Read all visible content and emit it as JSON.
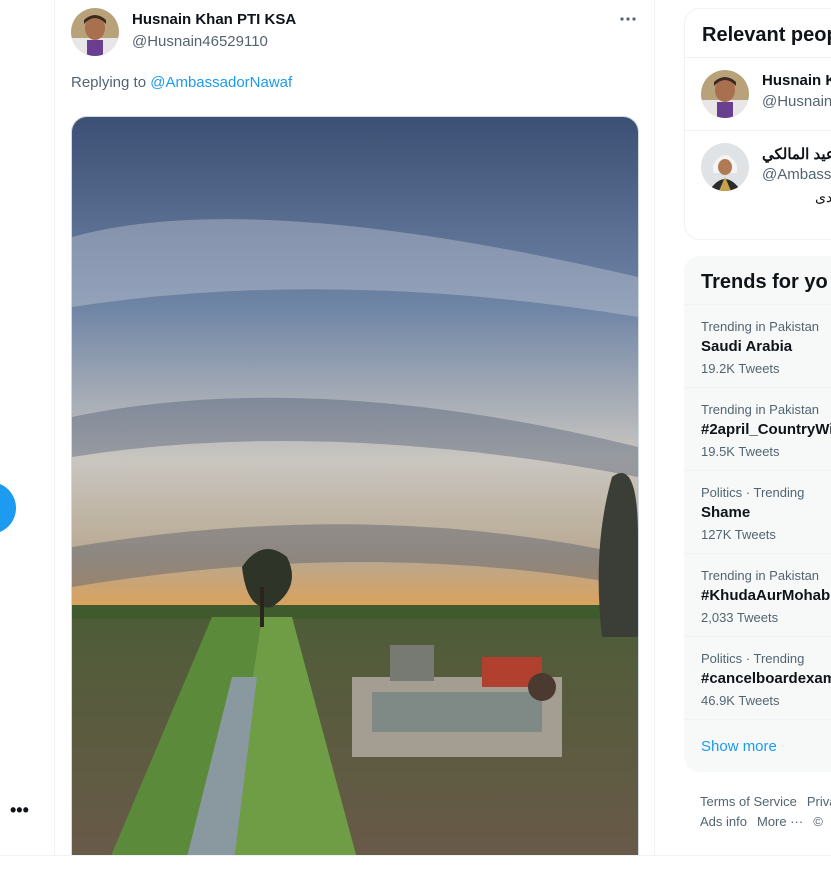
{
  "tweet": {
    "display_name": "Husnain Khan PTI KSA",
    "handle": "@Husnain46529110",
    "more_icon": "more-horizontal-icon",
    "replying_prefix": "Replying to",
    "replying_mention": "@AmbassadorNawaf"
  },
  "left_rail": {
    "more_label": "•••"
  },
  "relevant_people": {
    "title": "Relevant peop",
    "people": [
      {
        "name": "Husnain K",
        "handle": "@Husnain4",
        "bio": ""
      },
      {
        "name": "عيد المالكي",
        "handle": "@Ambassa",
        "bio": "دى"
      }
    ]
  },
  "trends": {
    "title": "Trends for yo",
    "items": [
      {
        "context": "Trending in Pakistan",
        "name": "Saudi Arabia",
        "count": "19.2K Tweets"
      },
      {
        "context": "Trending in Pakistan",
        "name": "#2april_CountryWi",
        "count": "19.5K Tweets"
      },
      {
        "context": "Politics · Trending",
        "name": "Shame",
        "count": "127K Tweets"
      },
      {
        "context": "Trending in Pakistan",
        "name": "#KhudaAurMohab",
        "count": "2,033 Tweets"
      },
      {
        "context": "Politics · Trending",
        "name": "#cancelboardexam",
        "count": "46.9K Tweets"
      }
    ],
    "show_more": "Show more"
  },
  "footer": {
    "terms": "Terms of Service",
    "privacy": "Priva",
    "ads": "Ads info",
    "more": "More ···",
    "copyright": "©"
  },
  "colors": {
    "accent": "#1d9bf0",
    "secondary_text": "#536471",
    "panel_bg": "#f7f9f9"
  }
}
